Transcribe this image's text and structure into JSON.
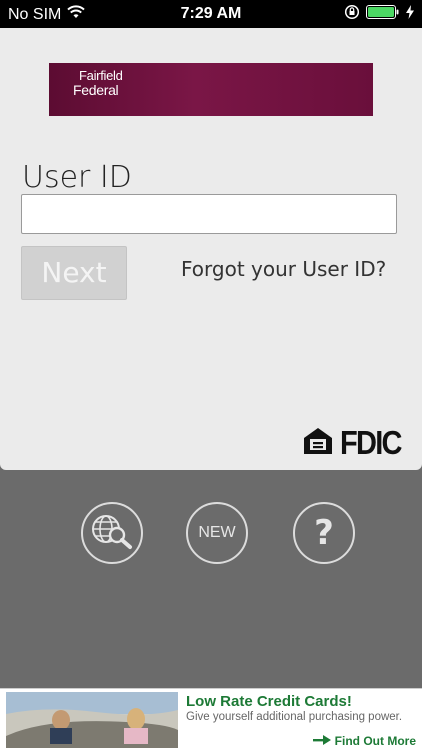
{
  "status_bar": {
    "carrier": "No SIM",
    "time": "7:29 AM"
  },
  "brand": {
    "logo_line1": "Fairfield",
    "logo_line2": "Federal",
    "color": "#6a0f3b"
  },
  "login": {
    "label": "User ID",
    "input_value": "",
    "input_placeholder": "",
    "next_label": "Next",
    "forgot_label": "Forgot your User ID?"
  },
  "footer_logos": {
    "fdic": "FDIC"
  },
  "actions": {
    "new_label": "NEW",
    "help_label": "?"
  },
  "ad": {
    "headline": "Low Rate Credit Cards!",
    "subtext": "Give yourself additional purchasing power.",
    "cta": "Find Out More",
    "accent": "#1d7a36"
  }
}
